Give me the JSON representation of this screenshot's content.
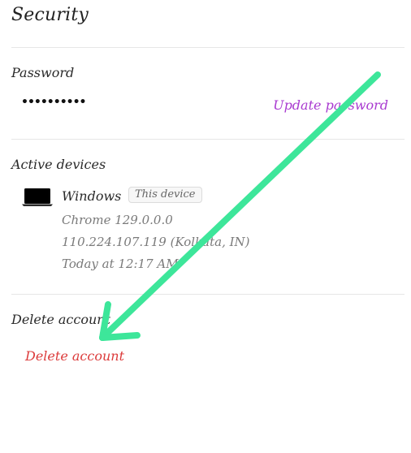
{
  "page": {
    "title": "Security"
  },
  "password": {
    "label": "Password",
    "masked_value": "••••••••••",
    "update_label": "Update password",
    "update_color": "#a93ad0"
  },
  "devices": {
    "label": "Active devices",
    "items": [
      {
        "icon": "laptop-icon",
        "name": "Windows",
        "badge": "This device",
        "browser": "Chrome 129.0.0.0",
        "location": "110.224.107.119 (Kolkata, IN)",
        "last_active": "Today at 12:17 AM"
      }
    ]
  },
  "delete_account": {
    "label": "Delete account",
    "action_label": "Delete account",
    "action_color": "#dc3b3b"
  },
  "annotation": {
    "icon": "arrow-icon",
    "color": "#3de69a"
  }
}
